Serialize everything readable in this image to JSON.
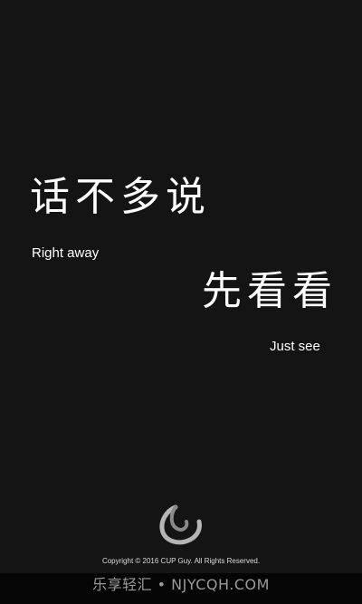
{
  "splash": {
    "headline_1": "话不多说",
    "subline_1": "Right away",
    "headline_2": "先看看",
    "subline_2": "Just see",
    "logo_icon": "swirl-logo-icon",
    "copyright": "Copyright © 2016 CUP Guy. All Rights Reserved."
  },
  "watermark": {
    "text": "乐享轻汇 • NJYCQH.COM"
  },
  "colors": {
    "background": "#141414",
    "text": "#ffffff",
    "logo": "#b5b5b5"
  }
}
